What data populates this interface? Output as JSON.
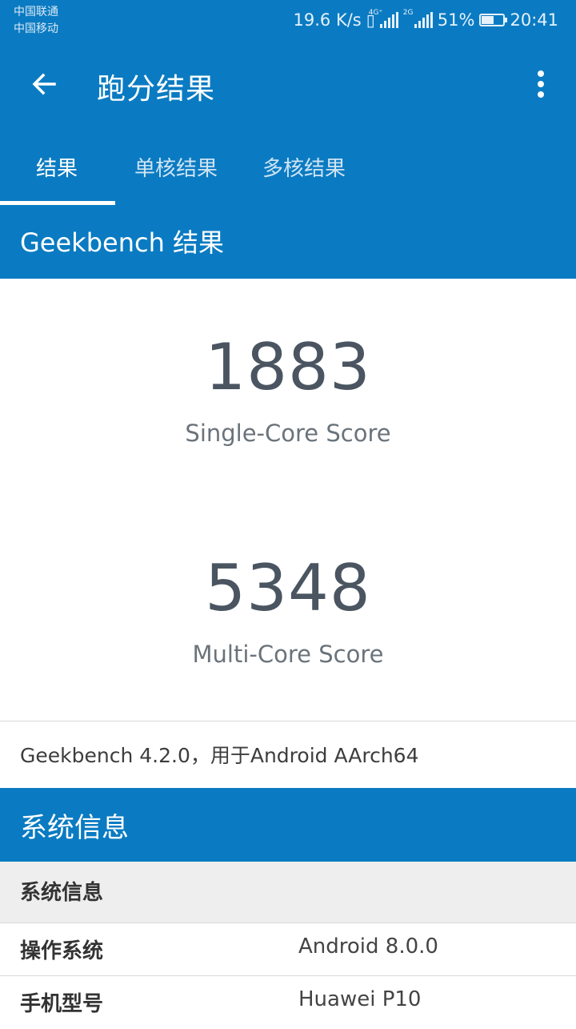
{
  "status_bar": {
    "carrier1": "中国联通",
    "carrier2": "中国移动",
    "speed": "19.6 K/s",
    "net1": "4G⁺",
    "net2": "2G",
    "battery_pct": "51%",
    "battery_level": 0.51,
    "time": "20:41"
  },
  "app_bar": {
    "title": "跑分结果"
  },
  "tabs": [
    {
      "label": "结果",
      "active": true
    },
    {
      "label": "单核结果",
      "active": false
    },
    {
      "label": "多核结果",
      "active": false
    }
  ],
  "results": {
    "header": "Geekbench 结果",
    "single_score": "1883",
    "single_label": "Single-Core Score",
    "multi_score": "5348",
    "multi_label": "Multi-Core Score",
    "version": "Geekbench 4.2.0，用于Android AArch64"
  },
  "system": {
    "header": "系统信息",
    "subheader": "系统信息",
    "rows": [
      {
        "key": "操作系统",
        "value": "Android 8.0.0"
      },
      {
        "key": "手机型号",
        "value": "Huawei P10"
      }
    ]
  },
  "colors": {
    "primary": "#0a7bc2"
  }
}
